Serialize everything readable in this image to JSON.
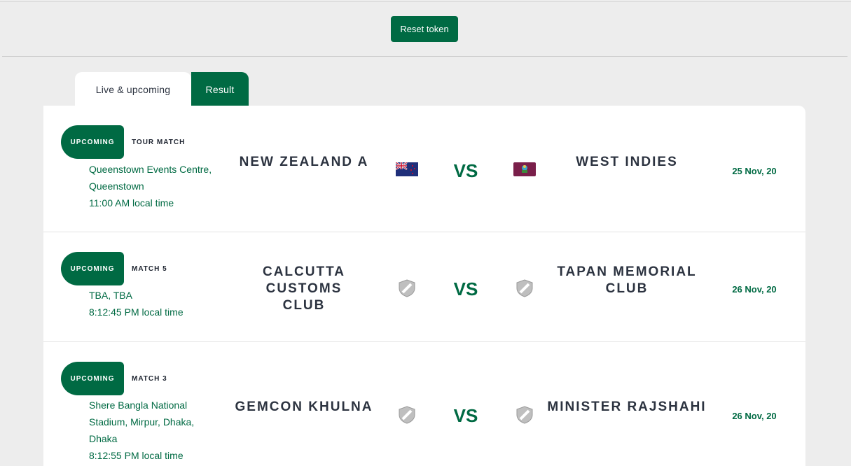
{
  "toolbar": {
    "reset_label": "Reset token"
  },
  "tabs": {
    "live": "Live & upcoming",
    "result": "Result"
  },
  "matches": [
    {
      "status": "UPCOMING",
      "match_label": "TOUR MATCH",
      "venue_line1": "Queenstown Events Centre,",
      "venue_line2": "Queenstown",
      "venue_line3": "",
      "time": "11:00 AM local time",
      "team1_line1": "NEW ZEALAND A",
      "team1_line2": "",
      "team1_flag": "new-zealand-flag",
      "vs": "VS",
      "team2_line1": "WEST INDIES",
      "team2_line2": "",
      "team2_flag": "west-indies-flag",
      "date": "25 Nov, 20"
    },
    {
      "status": "UPCOMING",
      "match_label": "MATCH 5",
      "venue_line1": "TBA, TBA",
      "venue_line2": "",
      "venue_line3": "",
      "time": "8:12:45 PM local time",
      "team1_line1": "CALCUTTA CUSTOMS",
      "team1_line2": "CLUB",
      "team1_flag": "shield-placeholder-icon",
      "vs": "VS",
      "team2_line1": "TAPAN MEMORIAL",
      "team2_line2": "CLUB",
      "team2_flag": "shield-placeholder-icon",
      "date": "26 Nov, 20"
    },
    {
      "status": "UPCOMING",
      "match_label": "MATCH 3",
      "venue_line1": "Shere Bangla National",
      "venue_line2": "Stadium, Mirpur, Dhaka,",
      "venue_line3": "Dhaka",
      "time": "8:12:55 PM local time",
      "team1_line1": "GEMCON KHULNA",
      "team1_line2": "",
      "team1_flag": "shield-placeholder-icon",
      "vs": "VS",
      "team2_line1": "MINISTER RAJSHAHI",
      "team2_line2": "",
      "team2_flag": "shield-placeholder-icon",
      "date": "26 Nov, 20"
    }
  ],
  "colors": {
    "brand": "#006a43",
    "text": "#2c3340",
    "background": "#ededed"
  }
}
